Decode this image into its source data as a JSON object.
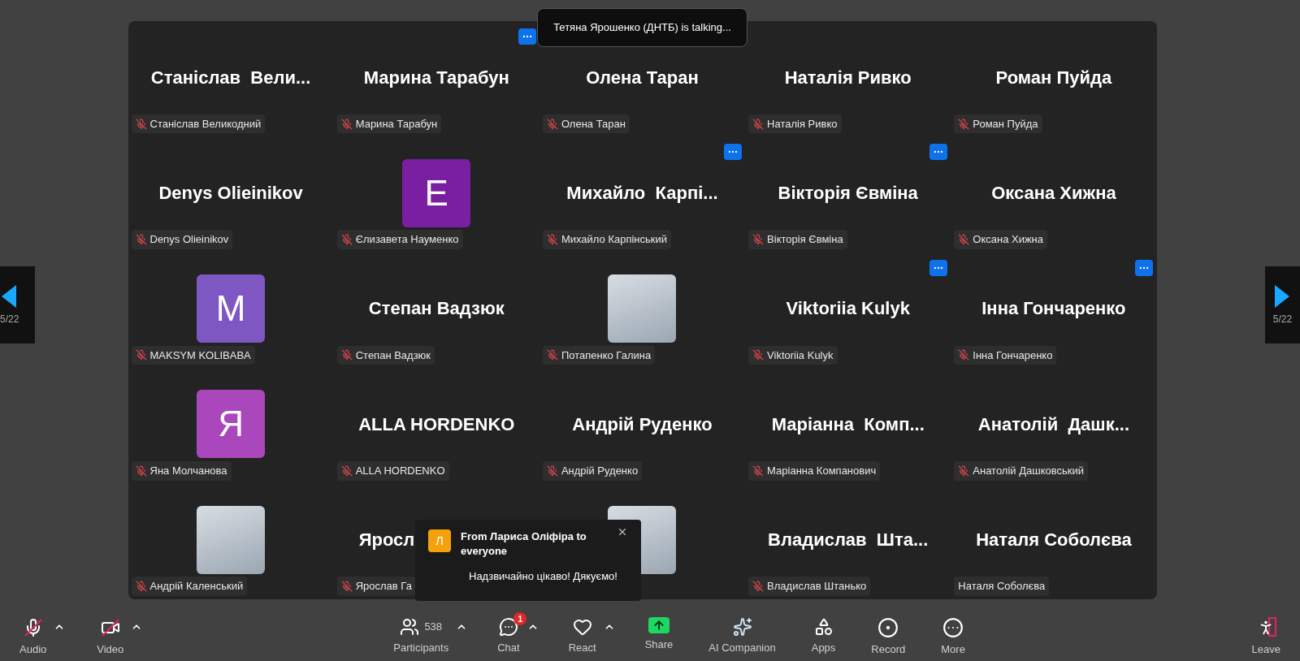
{
  "talking_toast": {
    "text": "Тетяна Ярошенко (ДНТБ) is talking..."
  },
  "nav": {
    "prev_page": "5/22",
    "next_page": "5/22"
  },
  "tiles": [
    {
      "kind": "name",
      "title": "Станіслав  Вели...",
      "label": "Станіслав Великодний",
      "muted": true
    },
    {
      "kind": "name",
      "title": "Марина Тарабун",
      "label": "Марина Тарабун",
      "muted": true,
      "more_button": true
    },
    {
      "kind": "name",
      "title": "Олена Таран",
      "label": "Олена Таран",
      "muted": true
    },
    {
      "kind": "name",
      "title": "Наталія Ривко",
      "label": "Наталія Ривко",
      "muted": true
    },
    {
      "kind": "name",
      "title": "Роман Пуйда",
      "label": "Роман Пуйда",
      "muted": true
    },
    {
      "kind": "name",
      "title": "Denys Olieinikov",
      "label": "Denys Olieinikov",
      "muted": true
    },
    {
      "kind": "avatar",
      "title": "E",
      "color": "#7b1fa2",
      "label": "Єлизавета Науменко",
      "muted": true
    },
    {
      "kind": "name",
      "title": "Михайло  Карпі...",
      "label": "Михайло Карпінський",
      "muted": true,
      "more_button": true
    },
    {
      "kind": "name",
      "title": "Вікторія Євміна",
      "label": "Вікторія Євміна",
      "muted": true,
      "more_button": true
    },
    {
      "kind": "name",
      "title": "Оксана Хижна",
      "label": "Оксана Хижна",
      "muted": true
    },
    {
      "kind": "avatar",
      "title": "M",
      "color": "#7e57c2",
      "label": "MAKSYM KOLIBABA",
      "muted": true
    },
    {
      "kind": "name",
      "title": "Степан Вадзюк",
      "label": "Степан Вадзюк",
      "muted": true
    },
    {
      "kind": "photo",
      "label": "Потапенко Галина",
      "muted": true
    },
    {
      "kind": "name",
      "title": "Viktoriia Kulyk",
      "label": "Viktoriia Kulyk",
      "muted": true,
      "more_button": true
    },
    {
      "kind": "name",
      "title": "Інна Гончаренко",
      "label": "Інна Гончаренко",
      "muted": true,
      "more_button": true
    },
    {
      "kind": "avatar",
      "title": "Я",
      "color": "#ab47bc",
      "label": "Яна Молчанова",
      "muted": true
    },
    {
      "kind": "name",
      "title": "ALLA HORDENKO",
      "label": "ALLA HORDENKO",
      "muted": true
    },
    {
      "kind": "name",
      "title": "Андрій Руденко",
      "label": "Андрій Руденко",
      "muted": true
    },
    {
      "kind": "name",
      "title": "Маріанна  Комп...",
      "label": "Маріанна Компанович",
      "muted": true
    },
    {
      "kind": "name",
      "title": "Анатолій  Дашк...",
      "label": "Анатолій Дашковський",
      "muted": true
    },
    {
      "kind": "photo",
      "label": "Андрій Каленський",
      "muted": true
    },
    {
      "kind": "partial",
      "title": "Яросл",
      "label": "Ярослав Га",
      "muted": true
    },
    {
      "kind": "photo"
    },
    {
      "kind": "name",
      "title": "Владислав  Шта...",
      "label": "Владислав Штанько",
      "muted": true
    },
    {
      "kind": "name",
      "title": "Наталя Соболєва",
      "label": "Наталя Соболєва",
      "muted": false
    }
  ],
  "chat_popup": {
    "avatar_letter": "Л",
    "sender": "From Лариса Оліфіра to everyone",
    "message": "Надзвичайно цікаво! Дякуємо!"
  },
  "toolbar": {
    "left": [
      {
        "kind": "audio",
        "label": "Audio",
        "off": true,
        "has_menu": true
      },
      {
        "kind": "video",
        "label": "Video",
        "off": true,
        "has_menu": true
      }
    ],
    "center": [
      {
        "kind": "participants",
        "label": "Participants",
        "count": "538",
        "has_menu": true
      },
      {
        "kind": "chat",
        "label": "Chat",
        "badge": "1",
        "has_menu": true
      },
      {
        "kind": "react",
        "label": "React",
        "has_menu": true
      },
      {
        "kind": "share",
        "label": "Share"
      },
      {
        "kind": "ai",
        "label": "AI Companion"
      },
      {
        "kind": "apps",
        "label": "Apps"
      },
      {
        "kind": "record",
        "label": "Record"
      },
      {
        "kind": "more",
        "label": "More"
      }
    ],
    "right": [
      {
        "kind": "leave",
        "label": "Leave"
      }
    ]
  }
}
